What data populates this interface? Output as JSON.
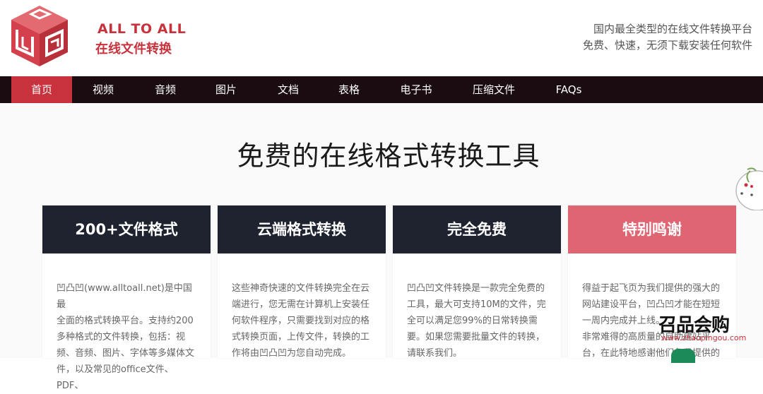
{
  "header": {
    "brand_en": "ALL TO ALL",
    "brand_cn": "在线文件转换",
    "tagline_1": "国内最全类型的在线文件转换平台",
    "tagline_2": "免费、快速，无须下载安装任何软件"
  },
  "nav": {
    "items": [
      {
        "label": "首页",
        "active": true
      },
      {
        "label": "视频"
      },
      {
        "label": "音频"
      },
      {
        "label": "图片"
      },
      {
        "label": "文档"
      },
      {
        "label": "表格"
      },
      {
        "label": "电子书"
      },
      {
        "label": "压缩文件"
      },
      {
        "label": "FAQs"
      }
    ]
  },
  "hero": {
    "title": "免费的在线格式转换工具"
  },
  "cards": [
    {
      "title": "200+文件格式",
      "lines": [
        "凹凸凹(www.alltoall.net)是中国最",
        "全面的格式转换平台。支持约200",
        "多种格式的文件转换，包括：视",
        "频、音频、图片、字体等多媒体文",
        "件，以及常见的office文件、PDF、"
      ]
    },
    {
      "title": "云端格式转换",
      "lines": [
        "这些神奇快速的文件转换完全在云",
        "端进行，您无需在计算机上安装任",
        "何软件程序，只需要找到对应的格",
        "式转换页面，上传文件，转换的工",
        "作将由凹凸凹为您自动完成。"
      ]
    },
    {
      "title": "完全免费",
      "lines": [
        "凹凸凹文件转换是一款完全免费的",
        "工具，最大可支持10M的文件，完",
        "全可以满足您99%的日常转换需",
        "要。如果您需要批量文件的转换，",
        "请联系我们。"
      ]
    },
    {
      "title": "特别鸣谢",
      "lines": [
        "得益于起飞页为我们提供的强大的",
        "网站建设平台，凹凸凹才能在短短",
        "一周内完成并上线。",
        "非常难得的高质量的自助建站平",
        "台，在此特地感谢他们免费提供的"
      ]
    }
  ],
  "watermark": {
    "text": "召品会购",
    "sub": "www.zhaopingou.com"
  },
  "colors": {
    "accent": "#c8323c",
    "nav_bg": "#1a0c10",
    "card_head": "#1f2330",
    "card_head_pink": "#e06572"
  }
}
